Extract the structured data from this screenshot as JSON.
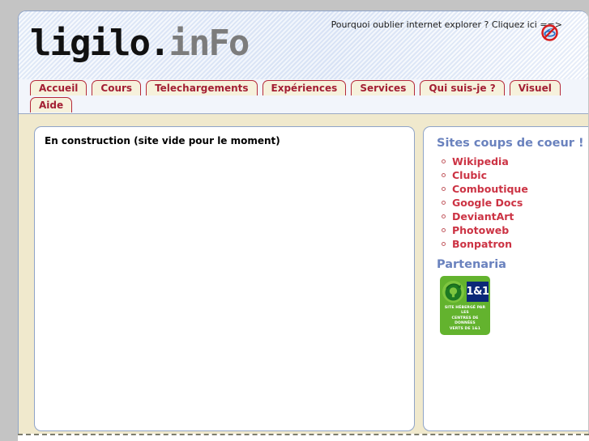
{
  "site": {
    "logo_dark": "ligilo.",
    "logo_gray": "inFo"
  },
  "header": {
    "ie_note": "Pourquoi oublier internet explorer ? Cliquez ici ==>",
    "ie_icon": "internet-explorer-forbidden-icon"
  },
  "nav": {
    "row1": [
      {
        "label": "Accueil"
      },
      {
        "label": "Cours"
      },
      {
        "label": "Telechargements"
      },
      {
        "label": "Expériences"
      },
      {
        "label": "Services"
      },
      {
        "label": "Qui suis-je ?"
      },
      {
        "label": "Visuel"
      }
    ],
    "row2": [
      {
        "label": "Aide"
      }
    ]
  },
  "main": {
    "message": "En construction (site vide pour le moment)"
  },
  "sidebar": {
    "favorites_heading": "Sites coups de coeur !",
    "favorites": [
      {
        "label": "Wikipedia"
      },
      {
        "label": "Clubic"
      },
      {
        "label": "Comboutique"
      },
      {
        "label": "Google Docs"
      },
      {
        "label": "DeviantArt"
      },
      {
        "label": "Photoweb"
      },
      {
        "label": "Bonpatron"
      }
    ],
    "partners_heading": "Partenaria",
    "badge": {
      "brand": "1&1",
      "line1": "SITE HÉBERGÉ PAR LES",
      "line2": "CENTRES DE DONNÉES",
      "line3": "VERTS DE 1&1",
      "logo_icon": "green-tree-recycle-icon"
    }
  },
  "footer": {
    "text": ""
  },
  "colors": {
    "page_background": "#c4c4c4",
    "panel_border": "#8fa4c8",
    "body_cream": "#f0e9cd",
    "tab_background": "#f6f1dc",
    "tab_border": "#b5293a",
    "tab_text": "#a31f33",
    "link_red": "#cc3344",
    "heading_blue": "#6a82be",
    "badge_green": "#63b32e",
    "badge_blue": "#0b2878"
  }
}
